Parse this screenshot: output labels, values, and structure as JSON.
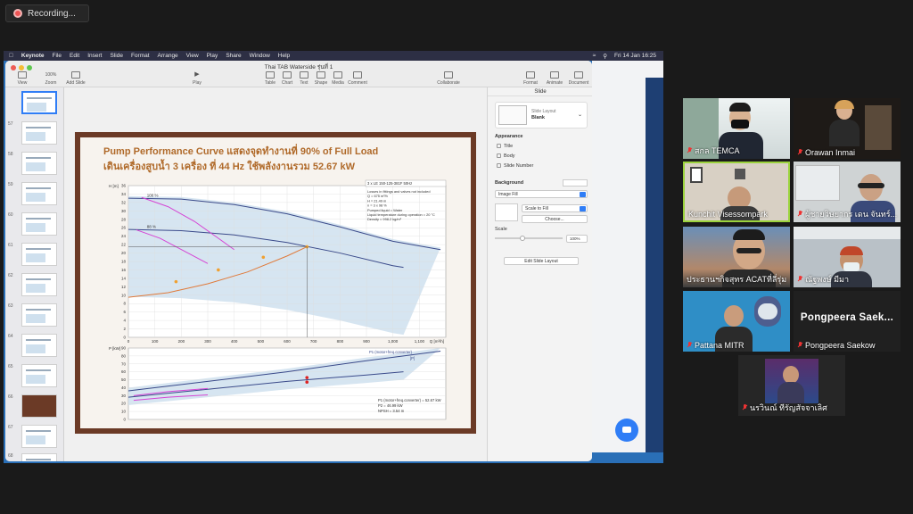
{
  "recording": {
    "label": "Recording..."
  },
  "mac_menubar": {
    "app": "Keynote",
    "items": [
      "File",
      "Edit",
      "Insert",
      "Slide",
      "Format",
      "Arrange",
      "View",
      "Play",
      "Share",
      "Window",
      "Help"
    ],
    "clock": "Fri 14 Jan  16:25"
  },
  "keynote": {
    "doc_title": "Thai TAB Waterside รุ่นที่ 1",
    "toolbar": {
      "view": "View",
      "zoom_value": "100%",
      "zoom": "Zoom",
      "add_slide": "Add Slide",
      "play": "Play",
      "table": "Table",
      "chart": "Chart",
      "text": "Text",
      "shape": "Shape",
      "media": "Media",
      "comment": "Comment",
      "collaborate": "Collaborate",
      "format": "Format",
      "animate": "Animate",
      "document": "Document"
    },
    "thumbnails": [
      "57",
      "58",
      "59",
      "60",
      "61",
      "62",
      "63",
      "64",
      "65",
      "66",
      "67",
      "68"
    ],
    "slide": {
      "title_line1": "Pump Performance Curve แสดงจุดทำงานที่ 90% of Full Load",
      "title_line2": "เดินเครื่องสูบน้ำ 3 เครื่อง ที่ 44 Hz ใช้พลังงานรวม 52.67 kW"
    },
    "inspector": {
      "tab": "Slide",
      "layout_label": "Slide Layout",
      "layout_value": "Blank",
      "appearance": "Appearance",
      "opt_title": "Title",
      "opt_body": "Body",
      "opt_slide_number": "Slide Number",
      "background": "Background",
      "fill_type": "Image Fill",
      "scale_to_fill": "Scale to Fill",
      "choose": "Choose...",
      "scale": "Scale",
      "scale_value": "100%",
      "edit_layout": "Edit Slide Layout"
    }
  },
  "chart_data": [
    {
      "type": "line",
      "title": "",
      "legend_box": "3 x LE 150-125-381F  50Hz",
      "ylabel": "H [m]",
      "xlabel": "Q [m³/h]",
      "xlim": [
        0,
        1200
      ],
      "ylim": [
        0,
        36
      ],
      "x_ticks": [
        0,
        100,
        200,
        300,
        400,
        500,
        600,
        700,
        800,
        900,
        1000,
        1100
      ],
      "x_tick_labels": [
        "0",
        "100",
        "200",
        "300",
        "400",
        "500",
        "600",
        "700",
        "800",
        "900",
        "1,000",
        "1,100"
      ],
      "y_ticks": [
        0,
        2,
        4,
        6,
        8,
        10,
        12,
        14,
        16,
        18,
        20,
        22,
        24,
        26,
        28,
        30,
        32,
        34,
        36
      ],
      "annotations": [
        "Losses in fittings and valves not included",
        "Q = 675 m³/h",
        "H = 21.49 m",
        "n = 3 x 98 %",
        "Pumped liquid = Water",
        "Liquid temperature during operation = 20 °C",
        "Density = 998.2 kg/m³"
      ],
      "curve_labels": [
        "100 %",
        "88 %"
      ],
      "series": [
        {
          "color": "#3a4a8a",
          "x": [
            0,
            200,
            400,
            600,
            800,
            1000,
            1180
          ],
          "y": [
            33,
            32.8,
            31.5,
            29.3,
            26.2,
            22.8,
            20.8
          ]
        },
        {
          "color": "#3a4a8a",
          "x": [
            0,
            200,
            400,
            600,
            800,
            1000,
            1040
          ],
          "y": [
            25.6,
            25.3,
            24.3,
            22.5,
            20.0,
            17.0,
            16.6
          ]
        },
        {
          "color": "#d545d5",
          "x": [
            50,
            150,
            250,
            340,
            400
          ],
          "y": [
            33.2,
            31,
            27.5,
            23.5,
            20.8
          ]
        },
        {
          "color": "#d545d5",
          "x": [
            30,
            120,
            210,
            300
          ],
          "y": [
            25.5,
            23.5,
            20.5,
            17.5
          ]
        },
        {
          "color": "#e07a3a",
          "x": [
            0,
            150,
            300,
            450,
            600,
            675
          ],
          "y": [
            9.5,
            10.6,
            12.7,
            15.5,
            19.3,
            21.49
          ]
        }
      ],
      "points": [
        {
          "x": 180,
          "y": 13.2
        },
        {
          "x": 340,
          "y": 16
        },
        {
          "x": 510,
          "y": 19
        },
        {
          "x": 675,
          "y": 21.49
        }
      ]
    },
    {
      "type": "line",
      "title": "",
      "ylabel": "P [kW]",
      "xlim": [
        0,
        1200
      ],
      "ylim": [
        0,
        90
      ],
      "y_ticks": [
        0,
        10,
        20,
        30,
        40,
        50,
        60,
        70,
        80,
        90
      ],
      "series_labels": [
        "P1 (motor+freq.converter)",
        "[P]"
      ],
      "annotations": [
        "P1 (motor+freq.converter) = 52.67 kW",
        "P2 = 46.99 kW",
        "NPSH = 3.54 m"
      ],
      "series": [
        {
          "color": "#3a4a8a",
          "x": [
            0,
            300,
            600,
            900,
            1180
          ],
          "y": [
            36,
            48,
            60,
            74,
            86
          ]
        },
        {
          "color": "#3a4a8a",
          "x": [
            0,
            300,
            600,
            900,
            1040
          ],
          "y": [
            28,
            38,
            48,
            56,
            60
          ]
        },
        {
          "color": "#d545d5",
          "x": [
            20,
            150,
            300
          ],
          "y": [
            30,
            35,
            39
          ]
        },
        {
          "color": "#d545d5",
          "x": [
            20,
            150,
            300
          ],
          "y": [
            24,
            28,
            31
          ]
        }
      ],
      "points": [
        {
          "x": 675,
          "y": 52.67
        },
        {
          "x": 675,
          "y": 46.99
        }
      ]
    }
  ],
  "participants": [
    {
      "name": "สกล TEMCA",
      "muted": true
    },
    {
      "name": "Orawan Inmai",
      "muted": true
    },
    {
      "name": "Kunchit Visessompark",
      "muted": false,
      "active": true
    },
    {
      "name": "ผู้ชายวิษยากร เดน จันทร์...",
      "muted": true
    },
    {
      "name": "ประธานฯกิจสุทร ACATที่ลี่รุ่ม",
      "muted": false
    },
    {
      "name": "ณัฐพงษ์ มีมา",
      "muted": true
    },
    {
      "name": "Pattana MITR",
      "muted": true
    },
    {
      "name": "Pongpeera Saekow",
      "muted": true,
      "video_off_label": "Pongpeera  Saek..."
    },
    {
      "name": "นรวินณ์ ทีรัญสัจจาเลิศ",
      "muted": true
    }
  ]
}
